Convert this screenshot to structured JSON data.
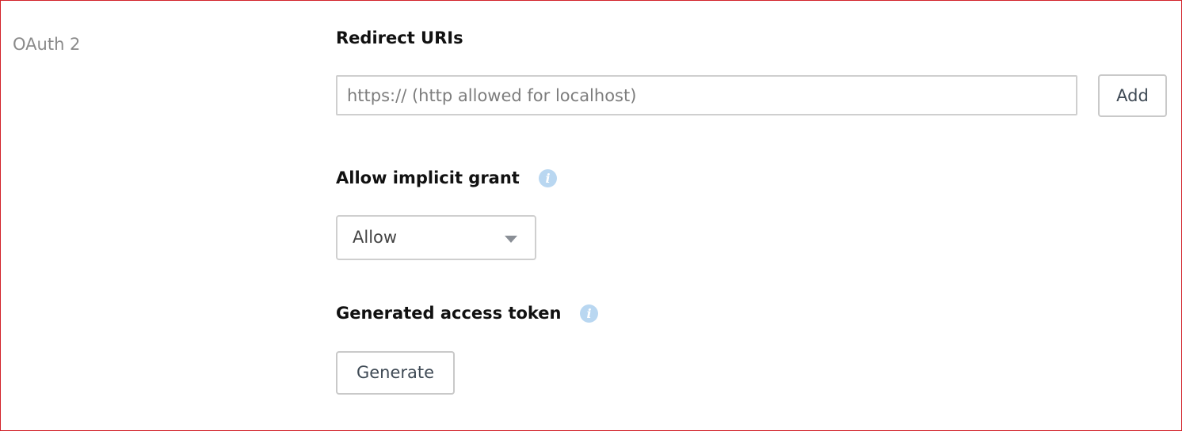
{
  "section": {
    "label": "OAuth 2"
  },
  "redirect_uris": {
    "heading": "Redirect URIs",
    "input_placeholder": "https:// (http allowed for localhost)",
    "input_value": "",
    "add_label": "Add"
  },
  "implicit_grant": {
    "heading": "Allow implicit grant",
    "info_icon": "i",
    "selected": "Allow"
  },
  "access_token": {
    "heading": "Generated access token",
    "info_icon": "i",
    "generate_label": "Generate"
  },
  "colors": {
    "frame_border": "#d2232a",
    "info_icon_bg": "#b9d7f1",
    "button_text": "#3f4a55"
  }
}
